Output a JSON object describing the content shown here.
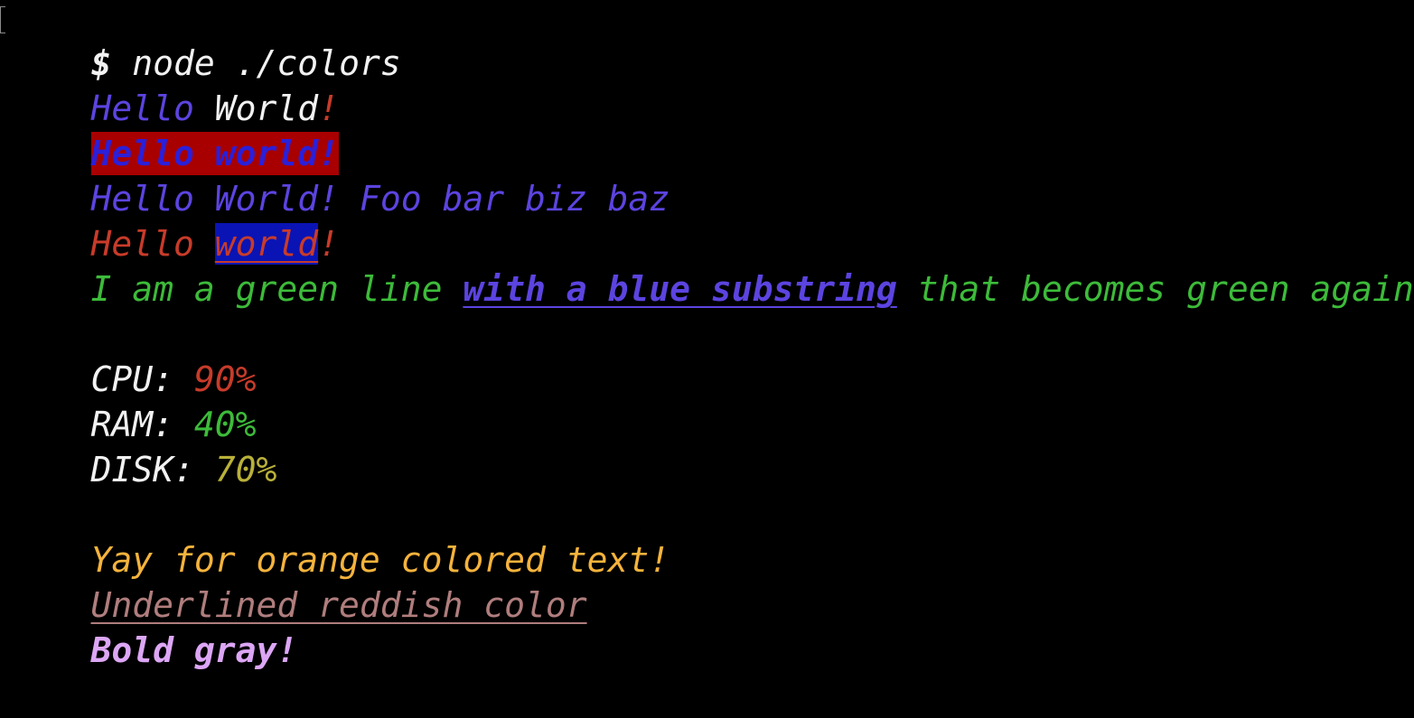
{
  "colors": {
    "background": "#000000",
    "white": "#f2f2f2",
    "blue": "#5b44e0",
    "red": "#c83b2a",
    "dark_red_bg": "#a80000",
    "dark_blue_text": "#2b1fd8",
    "blue_bg": "#0a14b4",
    "green": "#3dbb3a",
    "yellow": "#b9b13a",
    "orange": "#f5b33c",
    "reddish": "#b07d7d",
    "light_purple": "#dca6f5"
  },
  "prompt": {
    "symbol": "$",
    "command": " node ./colors"
  },
  "line1": {
    "hello": "Hello",
    "world": "World",
    "bang": "!"
  },
  "line2": {
    "text": "Hello world!"
  },
  "line3": {
    "hello_world": "Hello World!",
    "foo": "Foo bar biz baz"
  },
  "line4": {
    "hello": "Hello",
    "world": "world",
    "bang": "!"
  },
  "line5": {
    "green_start": "I am a green line",
    "blue_sub": "with a blue substring",
    "green_end": "that becomes green again!"
  },
  "stats": [
    {
      "label": "CPU:",
      "value": "90%"
    },
    {
      "label": "RAM:",
      "value": "40%"
    },
    {
      "label": "DISK:",
      "value": "70%"
    }
  ],
  "orange_line": "Yay for orange colored text!",
  "underlined_line": "Underlined reddish color",
  "bold_gray_line": "Bold gray!"
}
